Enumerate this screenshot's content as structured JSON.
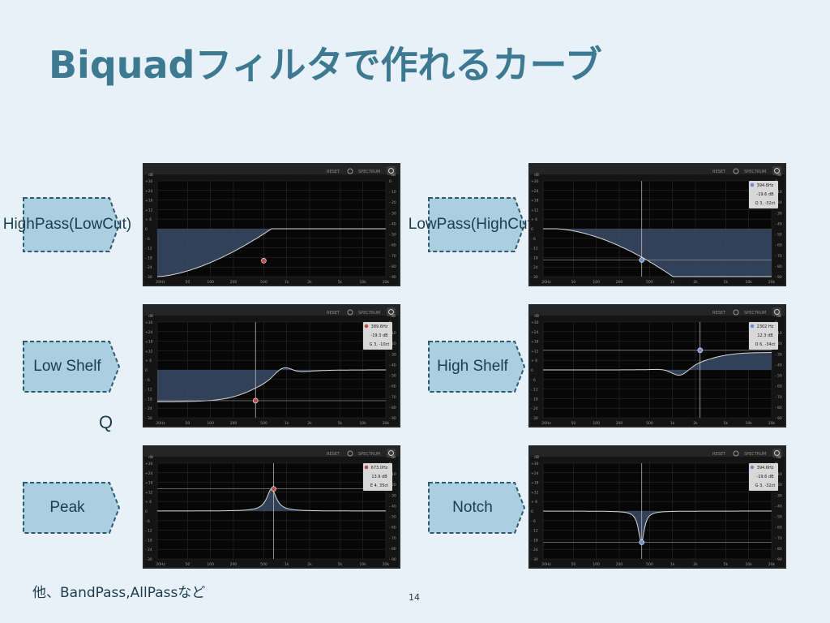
{
  "slide": {
    "title": "Biquadフィルタで作れるカーブ",
    "q_label": "Q",
    "footnote": "他、BandPass,AllPassなど",
    "page_number": "14"
  },
  "colors": {
    "title": "#3d7a92",
    "tag_fill": "#a9cfe0",
    "tag_border": "#2f5b70",
    "panel_bg": "#141414",
    "curve_fill": "#3a4a66"
  },
  "ui": {
    "reset": "RESET",
    "spectrum": "SPECTRUM",
    "db_unit": "dB",
    "left_ticks": [
      "+30",
      "+24",
      "+18",
      "+12",
      "+ 6",
      "0",
      "- 6",
      "- 12",
      "- 18",
      "- 24",
      "- 30"
    ],
    "right_ticks": [
      "0",
      "- 10",
      "- 20",
      "- 30",
      "- 40",
      "- 50",
      "- 60",
      "- 70",
      "- 80",
      "- 90"
    ],
    "freq_ticks": [
      "20Hz",
      "50",
      "100",
      "200",
      "500",
      "1k",
      "2k",
      "5k",
      "10k",
      "20k"
    ]
  },
  "filters": [
    {
      "label": "HighPass\n(LowCut)",
      "shape": "highpass",
      "node_color": "#c04a4a",
      "node_freq_hz": 500,
      "node_gain_db": -20,
      "cursor": false,
      "readout": null
    },
    {
      "label": "LowPass\n(HighCut)",
      "shape": "lowpass",
      "node_color": "#6f8fd0",
      "node_freq_hz": 394.6,
      "node_gain_db": -19.6,
      "cursor": true,
      "readout": [
        "394.6Hz",
        "-19.6 dB",
        "Q 3, -32ct"
      ]
    },
    {
      "label": "Low Shelf",
      "shape": "lowshelf",
      "node_color": "#c04a4a",
      "node_freq_hz": 389.6,
      "node_gain_db": -19.3,
      "cursor": true,
      "readout": [
        "389.6Hz",
        "-19.3 dB",
        "G 3, -10ct"
      ]
    },
    {
      "label": "High Shelf",
      "shape": "highshelf",
      "node_color": "#6f8fd0",
      "node_freq_hz": 2302,
      "node_gain_db": 12.3,
      "cursor": true,
      "readout": [
        "2302 Hz",
        "12.3 dB",
        "D 6, -34ct"
      ]
    },
    {
      "label": "Peak",
      "shape": "peak",
      "node_color": "#c04a4a",
      "node_freq_hz": 673,
      "node_gain_db": 13.9,
      "cursor": true,
      "readout": [
        "673.0Hz",
        "13.9 dB",
        "E 4, 35ct"
      ]
    },
    {
      "label": "Notch",
      "shape": "notch",
      "node_color": "#6f8fd0",
      "node_freq_hz": 394.6,
      "node_gain_db": -19.6,
      "cursor": true,
      "readout": [
        "394.6Hz",
        "-19.6 dB",
        "G 3, -32ct"
      ]
    }
  ]
}
